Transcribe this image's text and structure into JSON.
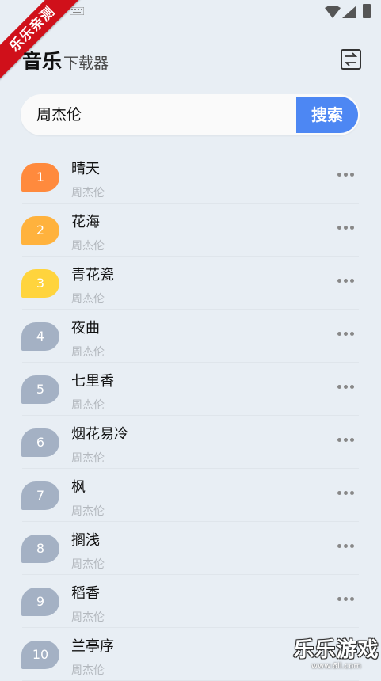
{
  "corner_badge": "乐乐亲测",
  "app": {
    "title": "音乐",
    "subtitle": "下载器"
  },
  "search": {
    "query": "周杰伦",
    "button_label": "搜索"
  },
  "songs": [
    {
      "rank": "1",
      "name": "晴天",
      "artist": "周杰伦",
      "badge_color": "#ff8a3d"
    },
    {
      "rank": "2",
      "name": "花海",
      "artist": "周杰伦",
      "badge_color": "#ffb23d"
    },
    {
      "rank": "3",
      "name": "青花瓷",
      "artist": "周杰伦",
      "badge_color": "#ffd43d"
    },
    {
      "rank": "4",
      "name": "夜曲",
      "artist": "周杰伦",
      "badge_color": "#a4b1c4"
    },
    {
      "rank": "5",
      "name": "七里香",
      "artist": "周杰伦",
      "badge_color": "#a4b1c4"
    },
    {
      "rank": "6",
      "name": "烟花易冷",
      "artist": "周杰伦",
      "badge_color": "#a4b1c4"
    },
    {
      "rank": "7",
      "name": "枫",
      "artist": "周杰伦",
      "badge_color": "#a4b1c4"
    },
    {
      "rank": "8",
      "name": "搁浅",
      "artist": "周杰伦",
      "badge_color": "#a4b1c4"
    },
    {
      "rank": "9",
      "name": "稻香",
      "artist": "周杰伦",
      "badge_color": "#a4b1c4"
    },
    {
      "rank": "10",
      "name": "兰亭序",
      "artist": "周杰伦",
      "badge_color": "#a4b1c4"
    }
  ],
  "watermark": {
    "text": "乐乐游戏",
    "url": "www.6ll.com"
  }
}
